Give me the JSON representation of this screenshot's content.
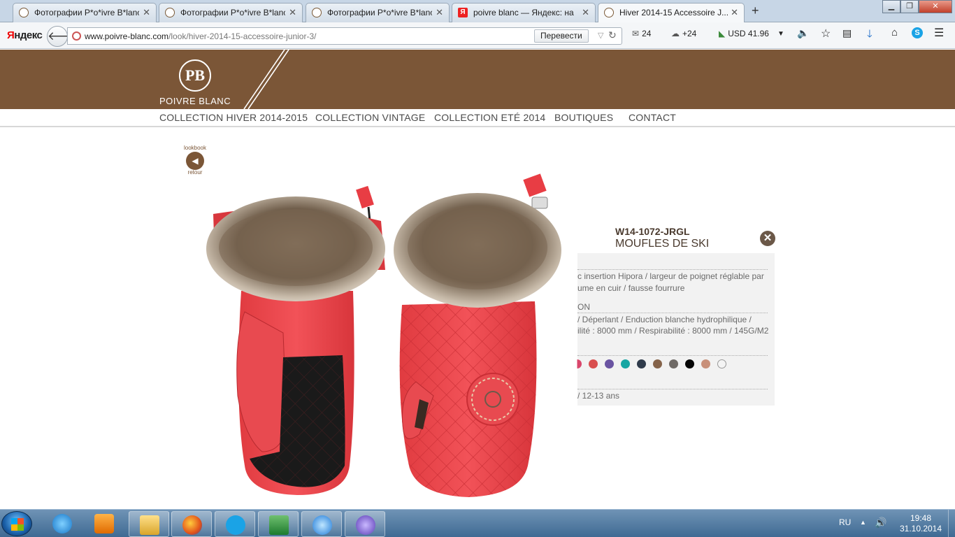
{
  "browser": {
    "tabs": [
      {
        "label": "Фотографии P*o*ivre B*lanc",
        "active": false
      },
      {
        "label": "Фотографии P*o*ivre B*lanc",
        "active": false
      },
      {
        "label": "Фотографии P*o*ivre B*lanc",
        "active": false
      },
      {
        "label": "poivre blanc — Яндекс: на",
        "active": false
      },
      {
        "label": "Hiver 2014-15 Accessoire J...",
        "active": true
      }
    ],
    "new_tab": "+",
    "close_glyph": "✕",
    "yandex_logo_a": "Я",
    "yandex_logo_b": "ндекс",
    "url_domain": "www.poivre-blanc.com",
    "url_path": "/look/hiver-2014-15-accessoire-junior-3/",
    "translate_button": "Перевести",
    "mail_count": "24",
    "weather": "+24",
    "currency": "USD 41.96"
  },
  "site": {
    "logo_monogram": "PB",
    "logo_text": "POIVRE BLANC",
    "nav": [
      "COLLECTION HIVER 2014-2015",
      "COLLECTION VINTAGE",
      "COLLECTION ETÉ 2014",
      "BOUTIQUES",
      "CONTACT"
    ],
    "back_top": "lookbook",
    "back_bottom": "retour"
  },
  "product": {
    "ref": "W14-1072-JRGL",
    "name": "MOUFLES DE SKI",
    "desc_line1": "c insertion Hipora / largeur de poignet réglable par",
    "desc_line2": "ume en cuir / fausse fourrure",
    "section2_label": "ON",
    "comp_line1": "/ Déperlant / Enduction blanche hydrophilique /",
    "comp_line2": "ilité : 8000 mm / Respirabilité : 8000 mm / 145G/M2",
    "sizes": "/ 12-13 ans",
    "swatches": [
      "#d9466b",
      "#d94f4f",
      "#6a54a2",
      "#17a6a3",
      "#2f3b4b",
      "#85634a",
      "#6f6a66",
      "#050505",
      "#c8907a",
      "#f4f4f4"
    ]
  },
  "taskbar": {
    "lang": "RU",
    "time": "19:48",
    "date": "31.10.2014"
  }
}
